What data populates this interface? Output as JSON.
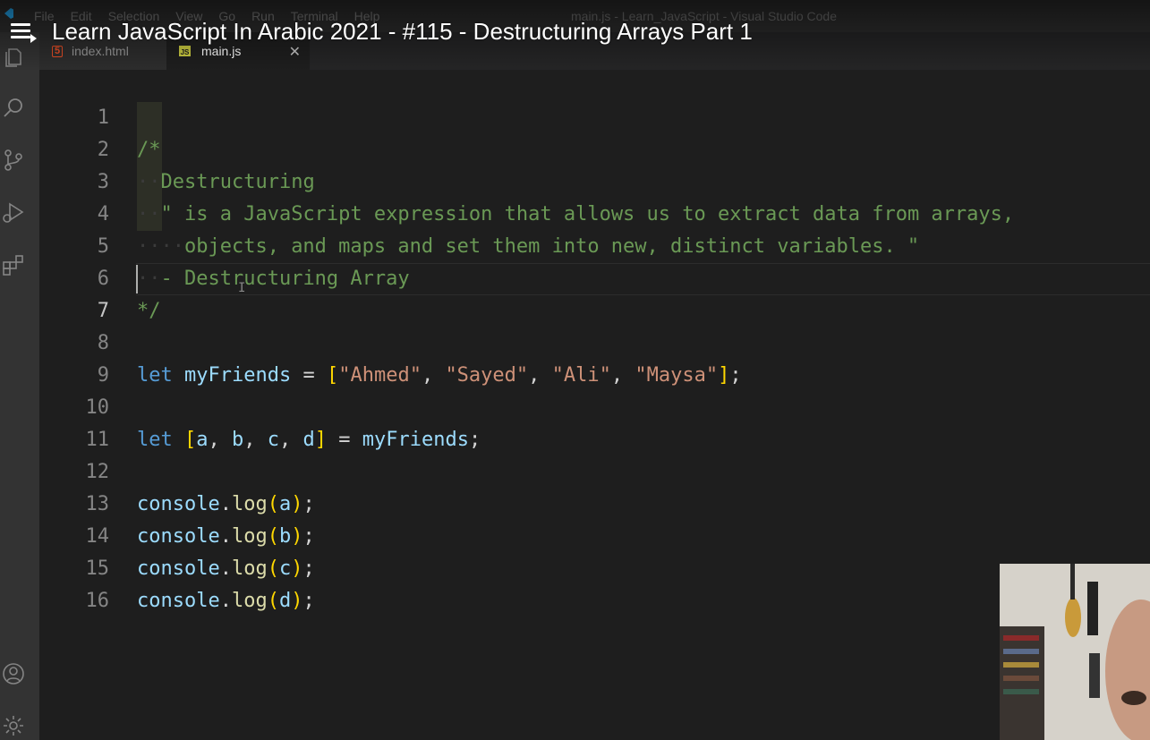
{
  "window": {
    "title": "main.js - Learn_JavaScript - Visual Studio Code",
    "menu": [
      "File",
      "Edit",
      "Selection",
      "View",
      "Go",
      "Run",
      "Terminal",
      "Help"
    ]
  },
  "video": {
    "title": "Learn JavaScript In Arabic 2021 - #115 - Destructuring Arrays Part 1"
  },
  "tabs": [
    {
      "label": "index.html",
      "icon": "html5-icon",
      "active": false
    },
    {
      "label": "main.js",
      "icon": "js-icon",
      "active": true
    }
  ],
  "editor": {
    "active_line": 7,
    "line_numbers": [
      "1",
      "2",
      "3",
      "4",
      "5",
      "6",
      "7",
      "8",
      "9",
      "10",
      "11",
      "12",
      "13",
      "14",
      "15",
      "16"
    ],
    "lines": {
      "l1": "/*",
      "l2": "Destructuring",
      "l3": "\" is a JavaScript expression that allows us to extract data from arrays,",
      "l4": "objects, and maps and set them into new, distinct variables. \"",
      "l5": "- Destructuring Array",
      "l6": "*/",
      "l8_kw": "let",
      "l8_var": "myFriends",
      "l8_s1": "\"Ahmed\"",
      "l8_s2": "\"Sayed\"",
      "l8_s3": "\"Ali\"",
      "l8_s4": "\"Maysa\"",
      "l10_kw": "let",
      "l10_a": "a",
      "l10_b": "b",
      "l10_c": "c",
      "l10_d": "d",
      "l10_var": "myFriends",
      "console": "console",
      "log": "log",
      "l12_arg": "a",
      "l13_arg": "b",
      "l14_arg": "c",
      "l15_arg": "d"
    }
  },
  "activity_bar": [
    "explorer-icon",
    "search-icon",
    "source-control-icon",
    "run-debug-icon",
    "extensions-icon",
    "account-icon",
    "settings-gear-icon"
  ],
  "colors": {
    "background": "#1e1e1e",
    "comment": "#6a9955",
    "keyword": "#569cd6",
    "variable": "#9cdcfe",
    "string": "#ce9178",
    "function": "#dcdcaa",
    "bracket": "#ffd700"
  }
}
